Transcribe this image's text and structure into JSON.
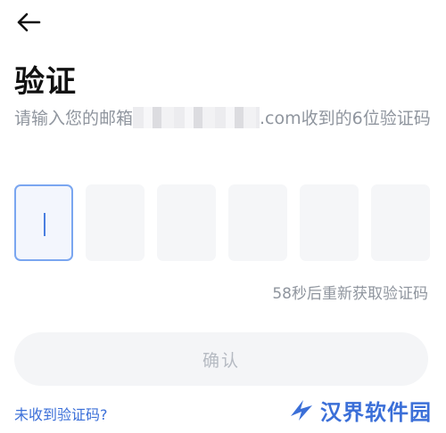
{
  "header": {
    "back_icon": "arrow-left-icon"
  },
  "title": "验证",
  "description": {
    "prefix": "请输入您的邮箱",
    "email_suffix": ".com",
    "suffix": "收到的6位验证码"
  },
  "code_input": {
    "length": 6,
    "values": [
      "",
      "",
      "",
      "",
      "",
      ""
    ],
    "active_index": 0
  },
  "resend_text": "58秒后重新获取验证码",
  "confirm_label": "确认",
  "no_code_link": "未收到验证码?",
  "watermark": {
    "text": "汉界软件园",
    "icon": "brand-logo-icon"
  },
  "colors": {
    "accent": "#3b6fd8",
    "active_border": "#7aa6f0",
    "muted_text": "#8f959e",
    "input_bg": "#f5f6f8"
  }
}
